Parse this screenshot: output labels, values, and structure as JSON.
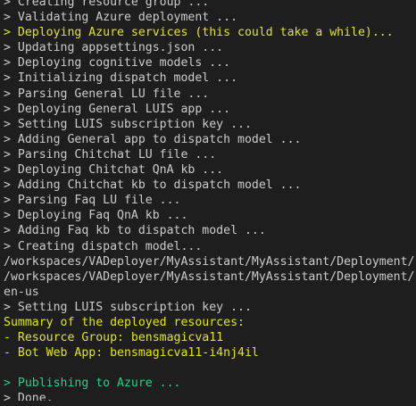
{
  "terminal": {
    "colors": {
      "background": "#1e1e1e",
      "default_text": "#cccccc",
      "yellow_text": "#e5e510",
      "green_text": "#23d18b"
    },
    "lines": [
      {
        "text": "> Creating resource group ...",
        "color": "white"
      },
      {
        "text": "> Validating Azure deployment ...",
        "color": "white"
      },
      {
        "text": "> Deploying Azure services (this could take a while)...",
        "color": "yellow"
      },
      {
        "text": "> Updating appsettings.json ...",
        "color": "white"
      },
      {
        "text": "> Deploying cognitive models ...",
        "color": "white"
      },
      {
        "text": "> Initializing dispatch model ...",
        "color": "white"
      },
      {
        "text": "> Parsing General LU file ...",
        "color": "white"
      },
      {
        "text": "> Deploying General LUIS app ...",
        "color": "white"
      },
      {
        "text": "> Setting LUIS subscription key ...",
        "color": "white"
      },
      {
        "text": "> Adding General app to dispatch model ...",
        "color": "white"
      },
      {
        "text": "> Parsing Chitchat LU file ...",
        "color": "white"
      },
      {
        "text": "> Deploying Chitchat QnA kb ...",
        "color": "white"
      },
      {
        "text": "> Adding Chitchat kb to dispatch model ...",
        "color": "white"
      },
      {
        "text": "> Parsing Faq LU file ...",
        "color": "white"
      },
      {
        "text": "> Deploying Faq QnA kb ...",
        "color": "white"
      },
      {
        "text": "> Adding Faq kb to dispatch model ...",
        "color": "white"
      },
      {
        "text": "> Creating dispatch model...",
        "color": "white"
      },
      {
        "text": "/workspaces/VADeployer/MyAssistant/MyAssistant/Deployment/",
        "color": "white"
      },
      {
        "text": "/workspaces/VADeployer/MyAssistant/MyAssistant/Deployment/",
        "color": "white"
      },
      {
        "text": "en-us",
        "color": "white"
      },
      {
        "text": "> Setting LUIS subscription key ...",
        "color": "white"
      },
      {
        "text": "Summary of the deployed resources:",
        "color": "yellow"
      },
      {
        "text": "- Resource Group: bensmagicva11",
        "color": "yellow"
      },
      {
        "text": "- Bot Web App: bensmagicva11-i4nj4il",
        "color": "yellow"
      },
      {
        "text": "",
        "color": "blank"
      },
      {
        "text": "> Publishing to Azure ...",
        "color": "green"
      },
      {
        "text": "> Done.",
        "color": "white"
      }
    ]
  }
}
